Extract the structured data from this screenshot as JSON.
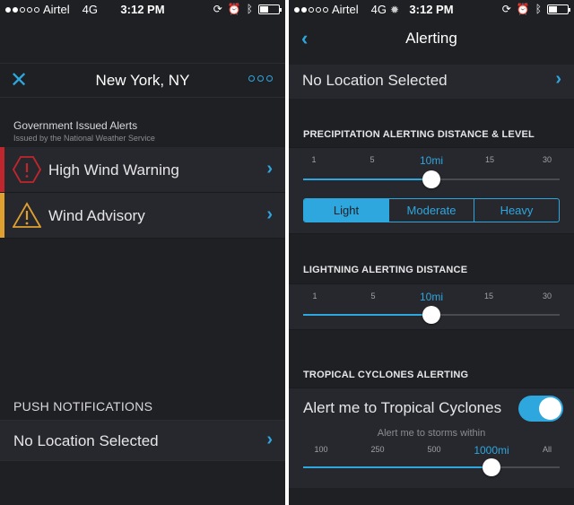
{
  "colors": {
    "accent": "#2ea6de",
    "warning": "#c0262d",
    "advisory": "#e0a030",
    "bg": "#1f2024",
    "row": "#27282d"
  },
  "left": {
    "status": {
      "carrier": "Airtel",
      "network": "4G",
      "time": "3:12 PM"
    },
    "header": {
      "title": "New York, NY",
      "close_icon": "close-icon",
      "more_icon": "more-icon"
    },
    "alerts_section": {
      "title": "Government Issued Alerts",
      "subtitle": "Issued by the National Weather Service"
    },
    "alerts": [
      {
        "label": "High Wind Warning",
        "icon": "warning-octagon-icon",
        "color": "#c0262d"
      },
      {
        "label": "Wind Advisory",
        "icon": "warning-triangle-icon",
        "color": "#e0a030"
      }
    ],
    "push": {
      "title": "PUSH NOTIFICATIONS",
      "location": "No Location Selected"
    }
  },
  "right": {
    "status": {
      "carrier": "Airtel",
      "network": "4G",
      "time": "3:12 PM"
    },
    "header": {
      "title": "Alerting"
    },
    "location": "No Location Selected",
    "precip": {
      "title": "PRECIPITATION ALERTING DISTANCE & LEVEL",
      "ticks": [
        "1",
        "5",
        "10mi",
        "15",
        "30"
      ],
      "selected_index": 2,
      "levels": [
        "Light",
        "Moderate",
        "Heavy"
      ],
      "selected_level": "Light"
    },
    "lightning": {
      "title": "LIGHTNING ALERTING DISTANCE",
      "ticks": [
        "1",
        "5",
        "10mi",
        "15",
        "30"
      ],
      "selected_index": 2
    },
    "tropical": {
      "title": "TROPICAL CYCLONES ALERTING",
      "toggle_label": "Alert me to Tropical Cyclones",
      "enabled": true,
      "within_label": "Alert me to storms within",
      "ticks": [
        "100",
        "250",
        "500",
        "1000mi",
        "All"
      ],
      "selected_index": 3
    }
  }
}
